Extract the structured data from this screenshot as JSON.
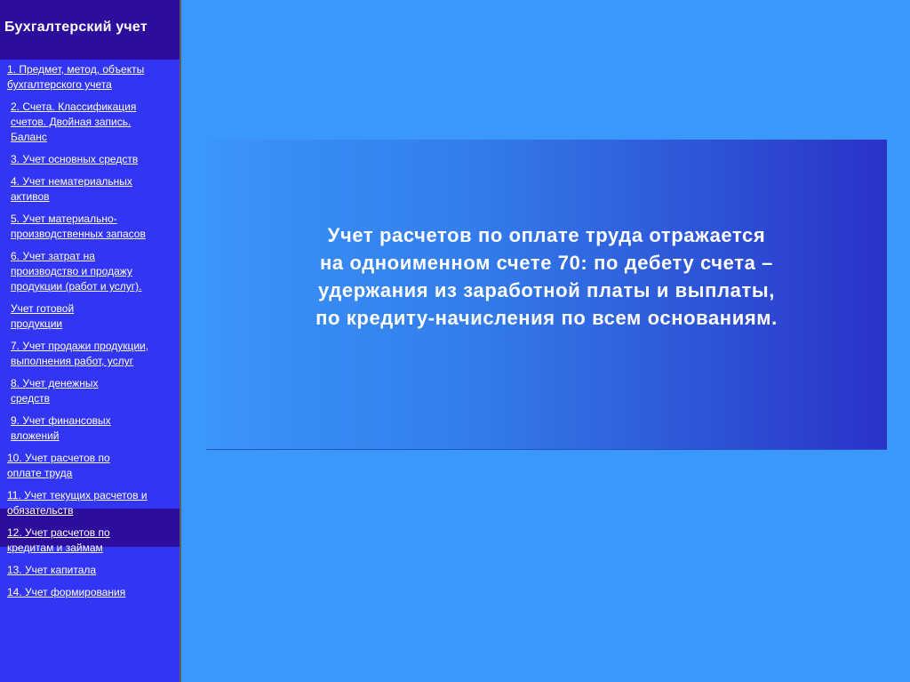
{
  "sidebar": {
    "title": "Бухгалтерский учет",
    "items": [
      {
        "label": "1. Предмет, метод, объекты бухгалтерского учета"
      },
      {
        "label": "2. Счета. Классификация счетов. Двойная запись. Баланс"
      },
      {
        "label": "3. Учет основных средств"
      },
      {
        "label": "4. Учет нематериальных активов"
      },
      {
        "label": "5. Учет материально-производственных запасов"
      },
      {
        "label": "6. Учет затрат на производство и продажу продукции (работ и услуг)."
      },
      {
        "label": "Учет готовой продукции"
      },
      {
        "label": "7. Учет продажи продукции, выполнения работ, услуг"
      },
      {
        "label": "8. Учет денежных средств"
      },
      {
        "label": "9. Учет финансовых вложений"
      },
      {
        "label": "10. Учет расчетов по оплате труда"
      },
      {
        "label": "11. Учет текущих расчетов и обязательств"
      },
      {
        "label": "12. Учет расчетов по кредитам и займам"
      },
      {
        "label": "13. Учет капитала"
      },
      {
        "label": "14. Учет формирования"
      }
    ]
  },
  "slide": {
    "lines": [
      "Учет расчетов по оплате труда отражается",
      "на одноименном счете 70: по дебету счета –",
      "удержания из заработной платы и выплаты,",
      "по кредиту-начисления по всем основаниям."
    ]
  },
  "colors": {
    "page_background": "#3a98fb",
    "sidebar_background": "#3236f3",
    "sidebar_header_background": "#2c0d9c",
    "panel_gradient_start": "#3b95fa",
    "panel_gradient_end": "#2a32c8",
    "text": "#ffffff"
  }
}
